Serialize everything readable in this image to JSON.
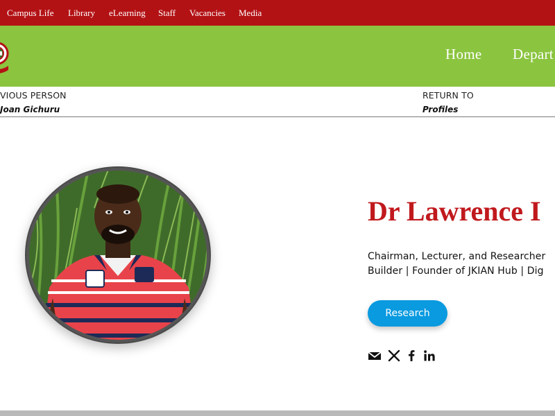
{
  "topbar": {
    "items": [
      "Campus Life",
      "Library",
      "eLearning",
      "Staff",
      "Vacancies",
      "Media"
    ]
  },
  "header": {
    "nav": [
      "Home",
      "Depart"
    ]
  },
  "navigation_strip": {
    "previous_label": "VIOUS PERSON",
    "previous_name": "Joan Gichuru",
    "return_label": "RETURN TO",
    "return_target": "Profiles"
  },
  "profile": {
    "name": "Dr Lawrence I",
    "bio_line1": "Chairman, Lecturer, and Researcher",
    "bio_line2": "Builder | Founder of JKIAN Hub | Dig",
    "research_button": "Research",
    "social": [
      "email-icon",
      "x-icon",
      "facebook-icon",
      "linkedin-icon"
    ]
  },
  "colors": {
    "topbar": "#b31215",
    "header": "#8bc43f",
    "name": "#c0191d",
    "button": "#0a9ae0"
  }
}
